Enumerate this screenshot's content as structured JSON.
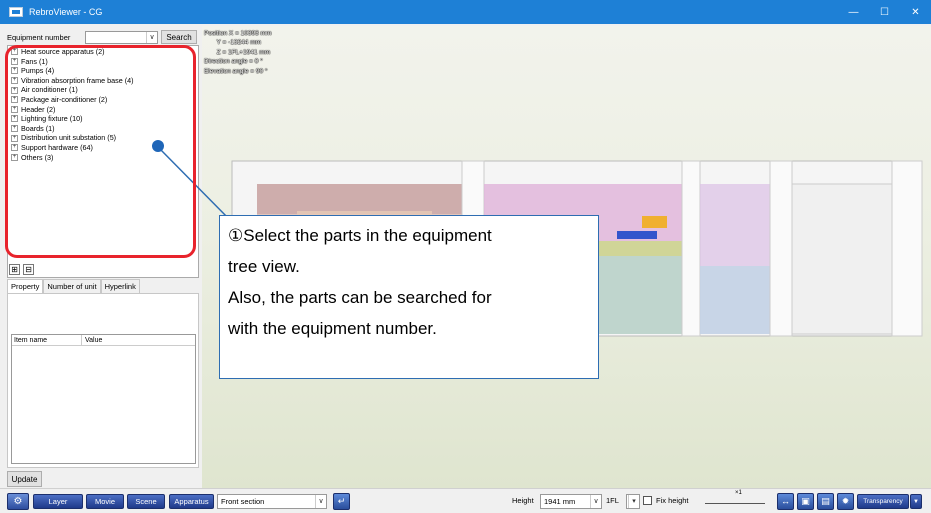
{
  "window": {
    "title": "RebroViewer - CG",
    "minimize_icon": "—",
    "maximize_icon": "☐",
    "close_icon": "✕"
  },
  "search": {
    "label": "Equipment number",
    "button": "Search"
  },
  "tree": {
    "items": [
      "Heat source apparatus (2)",
      "Fans (1)",
      "Pumps (4)",
      "Vibration absorption frame base (4)",
      "Air conditioner (1)",
      "Package air-conditioner (2)",
      "Header (2)",
      "Lighting fixture (10)",
      "Boards (1)",
      "Distribution unit substation (5)",
      "Support hardware (64)",
      "Others (3)"
    ]
  },
  "expand_buttons": {
    "expand": "⊞",
    "collapse": "⊟"
  },
  "tabs": [
    "Property",
    "Number of unit",
    "Hyperlink"
  ],
  "property_grid": {
    "col_name": "Item name",
    "col_value": "Value"
  },
  "update_button": "Update",
  "viewport": {
    "info_lines": [
      "Position X = 10393 mm",
      "       Y = -13244 mm",
      "       Z = 1FL+1941 mm",
      "Direction angle = 0 °",
      "Elevation angle = 90 °"
    ]
  },
  "callout": {
    "lines": [
      "①Select the parts in the equipment",
      "tree view.",
      "Also, the parts can be searched for",
      "with the equipment number."
    ]
  },
  "bottombar": {
    "layer": "Layer",
    "movie": "Movie",
    "scene": "Scene",
    "apparatus": "Apparatus",
    "section_select": "Front section",
    "height_label": "Height",
    "height_value": "1941 mm",
    "floor_value": "1FL",
    "fix_height": "Fix height",
    "zoom_label": "×1",
    "transparency": "Transparency"
  },
  "colors": {
    "titlebar": "#1e80d6",
    "highlight": "#e8232c",
    "callout_border": "#2e6db2"
  }
}
